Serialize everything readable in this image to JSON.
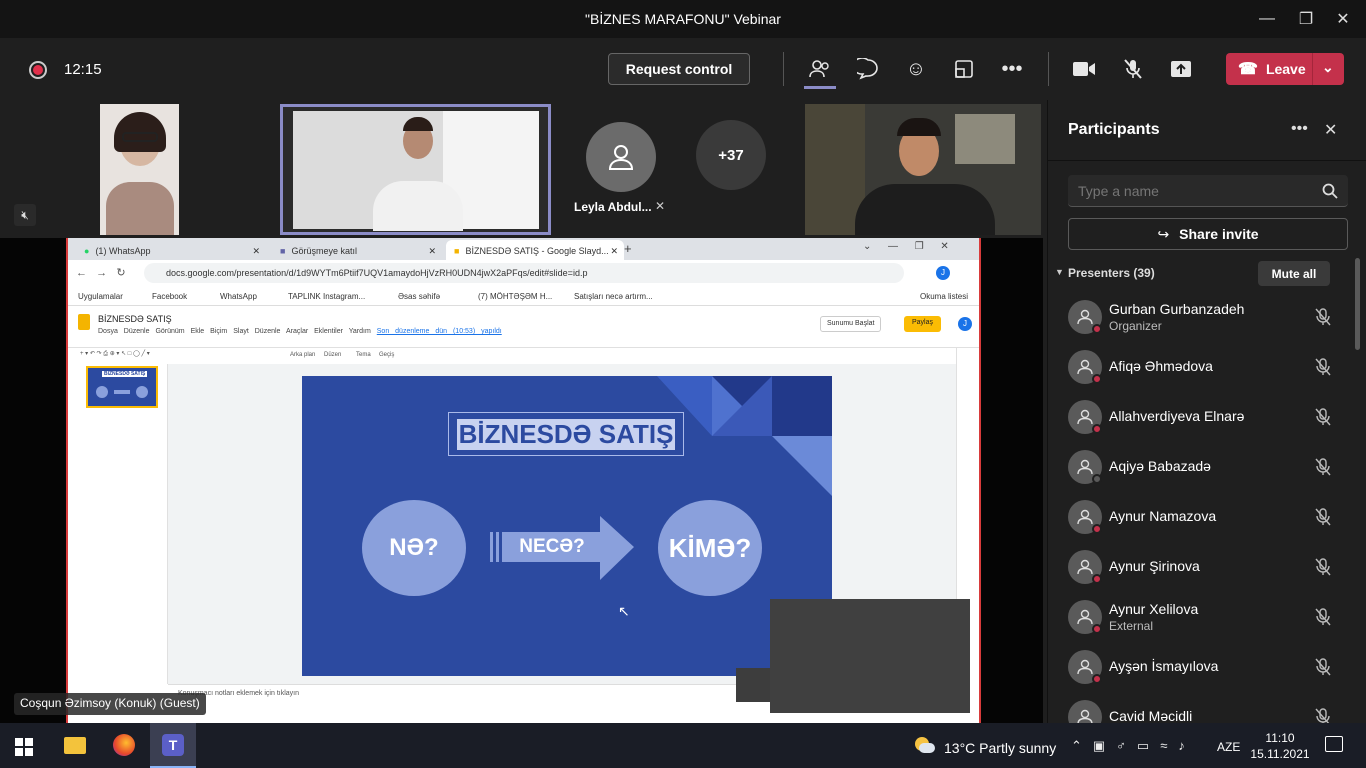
{
  "window": {
    "title": "\"BİZNES MARAFONU\" Vebinar"
  },
  "toolbar": {
    "time": "12:15",
    "request_label": "Request control",
    "leave_label": "Leave"
  },
  "videos": {
    "participant_name": "Leyla Abdul...",
    "overflow_count": "+37"
  },
  "speaker_label": "Coşqun Əzimsoy (Konuk) (Guest)",
  "browser": {
    "tabs": [
      "(1) WhatsApp",
      "Görüşmeye katıl",
      "BİZNESDƏ SATIŞ - Google Slayd..."
    ],
    "url": "docs.google.com/presentation/d/1d9WYTm6Ptiif7UQV1amaydoHjVzRH0UDN4jwX2aPFqs/edit#slide=id.p",
    "bookmarks": [
      "Uygulamalar",
      "Facebook",
      "WhatsApp",
      "TAPLINK Instagram...",
      "Əsas səhifə",
      "(7) MÖHTƏŞƏM H...",
      "Satışları necə artırm...",
      "Okuma listesi"
    ],
    "slides": {
      "doc_title": "BİZNESDƏ SATIŞ",
      "menus": [
        "Dosya",
        "Düzenle",
        "Görünüm",
        "Ekle",
        "Biçim",
        "Slayt",
        "Düzenle",
        "Araçlar",
        "Eklentiler",
        "Yardım"
      ],
      "last_edit": "Son düzenleme dün (10:53) yapıldı",
      "present_label": "Sunumu Başlat",
      "share_label": "Paylaş",
      "toolbar_items": [
        "Arka plan",
        "Düzen",
        "Tema",
        "Geçiş"
      ],
      "speaker_notes": "Konuşmacı notları eklemek için tıklayın",
      "slide_title": "BİZNESDƏ SATIŞ",
      "circle_left": "NƏ?",
      "arrow_text": "NECƏ?",
      "circle_right": "KİMƏ?",
      "thumb_title": "BİZNESDƏ SATIŞ"
    }
  },
  "panel": {
    "title": "Participants",
    "search_placeholder": "Type a name",
    "share_invite": "Share invite",
    "presenters_label": "Presenters (39)",
    "mute_all": "Mute all",
    "participants": [
      {
        "name": "Gurban Gurbanzadeh",
        "role": "Organizer"
      },
      {
        "name": "Afiqə Əhmədova",
        "role": ""
      },
      {
        "name": "Allahverdiyeva Elnarə",
        "role": ""
      },
      {
        "name": "Aqiyə Babazadə",
        "role": ""
      },
      {
        "name": "Aynur Namazova",
        "role": ""
      },
      {
        "name": "Aynur Şirinova",
        "role": ""
      },
      {
        "name": "Aynur Xelilova",
        "role": "External"
      },
      {
        "name": "Ayşən İsmayılova",
        "role": ""
      },
      {
        "name": "Cavid Məcidli",
        "role": ""
      }
    ]
  },
  "taskbar": {
    "weather": "13°C  Partly sunny",
    "lang": "AZE",
    "time": "11:10",
    "date": "15.11.2021"
  },
  "colors": {
    "slide_blue": "#2c4aa0",
    "leave_red": "#c4314b",
    "accent": "#6264a7"
  }
}
